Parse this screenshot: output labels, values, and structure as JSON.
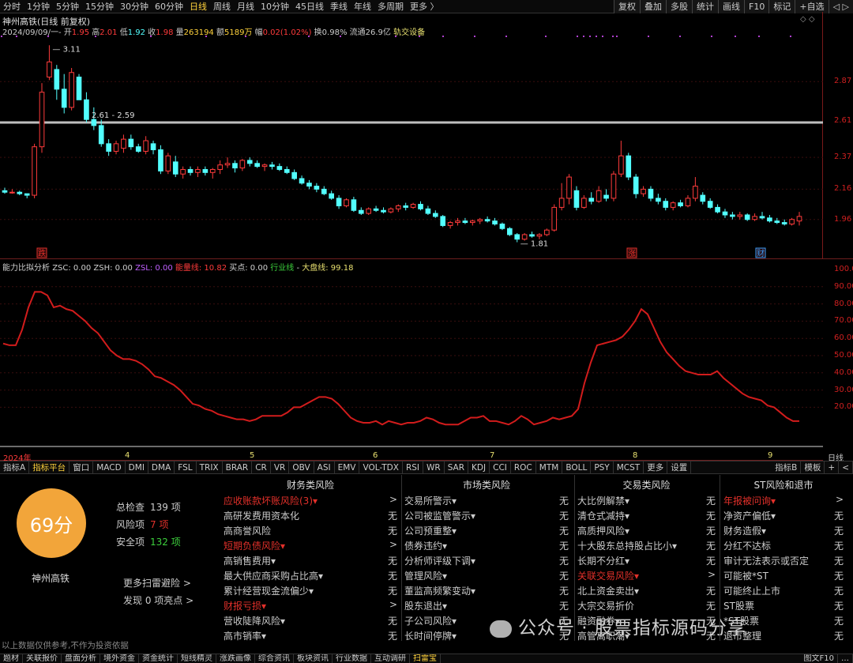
{
  "toolbar": {
    "periods": [
      "分时",
      "1分钟",
      "5分钟",
      "15分钟",
      "30分钟",
      "60分钟",
      "日线",
      "周线",
      "月线",
      "10分钟",
      "45日线",
      "季线",
      "年线",
      "多周期",
      "更多 〉"
    ],
    "active_period": "日线",
    "tools": [
      "复权",
      "叠加",
      "多股",
      "统计",
      "画线",
      "F10",
      "标记",
      "+自选",
      "◁ ▷"
    ]
  },
  "stock": {
    "title": "神州高铁(日线 前复权)",
    "date": "2024/09/09/一",
    "open_l": "开",
    "open": "1.95",
    "high_l": "高",
    "high": "2.01",
    "low_l": "低",
    "low": "1.92",
    "close_l": "收",
    "close": "1.98",
    "vol_l": "量",
    "vol": "263194",
    "amt_l": "额",
    "amt": "5189万",
    "chg_l": "幅",
    "chg": "0.02(1.02%)",
    "turn_l": "换",
    "turn": "0.98%",
    "float_l": "流通",
    "float": "26.9亿",
    "sector": "轨交设备",
    "flags": "◇ ◇"
  },
  "price_axis": [
    "2.87",
    "2.61",
    "2.37",
    "2.16",
    "1.96"
  ],
  "annotations": {
    "high": "3.11",
    "line": "2.61 - 2.59",
    "low": "1.81",
    "m1": "跌",
    "m2": "涨",
    "m3": "财"
  },
  "indicator": {
    "name": "能力比拟分析",
    "zsc": "ZSC: 0.00",
    "zsh": "ZSH: 0.00",
    "zsl": "ZSL: 0.00",
    "energy": "能量线: 10.82",
    "buy": "买点: 0.00",
    "industry": "行业线",
    "market": "大盘线: 99.18",
    "sep": "-"
  },
  "ind_axis": [
    "100.00",
    "90.00",
    "80.00",
    "70.00",
    "60.00",
    "50.00",
    "40.00",
    "30.00",
    "20.00"
  ],
  "date_axis": {
    "year": "2024年",
    "m4": "4",
    "m5": "5",
    "m6": "6",
    "m7": "7",
    "m8": "8",
    "m9": "9",
    "period": "日线"
  },
  "bottom_tabs": [
    "指标A",
    "指标平台",
    "窗口",
    "MACD",
    "DMI",
    "DMA",
    "FSL",
    "TRIX",
    "BRAR",
    "CR",
    "VR",
    "OBV",
    "ASI",
    "EMV",
    "VOL-TDX",
    "RSI",
    "WR",
    "SAR",
    "KDJ",
    "CCI",
    "ROC",
    "MTM",
    "BOLL",
    "PSY",
    "MCST",
    "更多",
    "设置"
  ],
  "bottom_right": [
    "指标B",
    "模板",
    "+",
    "<"
  ],
  "colors": {
    "up": "#ff3b3b",
    "down": "#52ffff",
    "ma": "#bfbfbf",
    "ind": "#d21c1c",
    "score": "#f2a53a"
  },
  "risk": {
    "score": "69分",
    "name": "神州高铁",
    "total_l": "总检查",
    "total": "139 项",
    "risk_l": "风险项",
    "risk": "7 项",
    "safe_l": "安全项",
    "safe": "132 项",
    "more": "更多扫雷避险 >",
    "found": "发现 0 项亮点 >"
  },
  "sections": [
    {
      "title": "财务类风险",
      "rows": [
        [
          "应收账款坏账风险(3)▾",
          ">"
        ],
        [
          "高研发费用资本化",
          "无"
        ],
        [
          "高商誉风险",
          "无"
        ],
        [
          "短期负债风险▾",
          ">"
        ],
        [
          "高销售费用▾",
          "无"
        ],
        [
          "最大供应商采购占比高▾",
          "无"
        ],
        [
          "累计经营现金流偏少▾",
          "无"
        ],
        [
          "财报亏损▾",
          ">"
        ],
        [
          "营收陡降风险▾",
          "无"
        ],
        [
          "高市销率▾",
          "无"
        ]
      ]
    },
    {
      "title": "市场类风险",
      "rows": [
        [
          "交易所警示▾",
          "无"
        ],
        [
          "公司被监管警示▾",
          "无"
        ],
        [
          "公司预重整▾",
          "无"
        ],
        [
          "债券违约▾",
          "无"
        ],
        [
          "分析师评级下调▾",
          "无"
        ],
        [
          "管理风险▾",
          "无"
        ],
        [
          "董监高频繁变动▾",
          "无"
        ],
        [
          "股东退出▾",
          "无"
        ],
        [
          "子公司风险▾",
          "无"
        ],
        [
          "长时间停牌▾",
          "无"
        ]
      ]
    },
    {
      "title": "交易类风险",
      "rows": [
        [
          "大比例解禁▾",
          "无"
        ],
        [
          "清仓式减持▾",
          "无"
        ],
        [
          "高质押风险▾",
          "无"
        ],
        [
          "十大股东总持股占比小▾",
          "无"
        ],
        [
          "长期不分红▾",
          "无"
        ],
        [
          "关联交易风险▾",
          ">"
        ],
        [
          "北上资金卖出▾",
          "无"
        ],
        [
          "大宗交易折价",
          "无"
        ],
        [
          "融资融券▾",
          "无"
        ],
        [
          "高管离职潮▾",
          "无"
        ]
      ]
    },
    {
      "title": "ST风险和退市",
      "rows": [
        [
          "年报被问询▾",
          ">"
        ],
        [
          "净资产偏低▾",
          "无"
        ],
        [
          "财务造假▾",
          "无"
        ],
        [
          "分红不达标",
          "无"
        ],
        [
          "审计无法表示或否定",
          "无"
        ],
        [
          "可能被*ST",
          "无"
        ],
        [
          "可能终止上市",
          "无"
        ],
        [
          "ST股票",
          "无"
        ],
        [
          "*ST股票",
          "无"
        ],
        [
          "退市整理",
          "无"
        ]
      ]
    }
  ],
  "red_rows": {
    "s0": [
      0,
      3,
      7
    ],
    "s2": [
      5
    ],
    "s3": [
      0
    ]
  },
  "footer_note": "以上数据仅供参考,不作为投资依据",
  "watermark": "公众号 · 股票指标源码分享",
  "bottom_nav": [
    "题材",
    "关联报价",
    "盘面分析",
    "境外资金",
    "资金统计",
    "短线精灵",
    "涨跌画像",
    "综合资讯",
    "板块资讯",
    "行业数据",
    "互动调研",
    "扫雷宝"
  ],
  "bottom_nav_right": [
    "图文F10",
    "…"
  ],
  "chart_data": {
    "type": "candlestick",
    "price_range": [
      1.75,
      3.2
    ],
    "period_high": 3.11,
    "period_low": 1.81,
    "ohlc": [
      [
        2.15,
        2.17,
        2.13,
        2.14
      ],
      [
        2.14,
        2.16,
        2.13,
        2.14
      ],
      [
        2.14,
        2.15,
        2.12,
        2.13
      ],
      [
        2.13,
        2.13,
        2.1,
        2.12
      ],
      [
        2.12,
        2.46,
        2.1,
        2.44
      ],
      [
        2.44,
        2.86,
        2.4,
        2.8
      ],
      [
        2.9,
        3.11,
        2.88,
        3.0
      ],
      [
        2.95,
        2.98,
        2.75,
        2.82
      ],
      [
        2.82,
        2.92,
        2.66,
        2.7
      ],
      [
        2.7,
        2.96,
        2.68,
        2.93
      ],
      [
        2.9,
        2.92,
        2.75,
        2.75
      ],
      [
        2.75,
        2.8,
        2.6,
        2.62
      ],
      [
        2.62,
        2.7,
        2.55,
        2.58
      ],
      [
        2.58,
        2.62,
        2.44,
        2.46
      ],
      [
        2.46,
        2.49,
        2.38,
        2.41
      ],
      [
        2.41,
        2.48,
        2.39,
        2.46
      ],
      [
        2.43,
        2.52,
        2.4,
        2.49
      ],
      [
        2.49,
        2.52,
        2.42,
        2.44
      ],
      [
        2.44,
        2.46,
        2.4,
        2.41
      ],
      [
        2.41,
        2.51,
        2.39,
        2.48
      ],
      [
        2.46,
        2.48,
        2.39,
        2.42
      ],
      [
        2.42,
        2.45,
        2.26,
        2.28
      ],
      [
        2.28,
        2.4,
        2.26,
        2.38
      ],
      [
        2.34,
        2.38,
        2.24,
        2.26
      ],
      [
        2.26,
        2.31,
        2.23,
        2.29
      ],
      [
        2.29,
        2.31,
        2.25,
        2.27
      ],
      [
        2.27,
        2.31,
        2.24,
        2.29
      ],
      [
        2.29,
        2.31,
        2.25,
        2.27
      ],
      [
        2.27,
        2.3,
        2.23,
        2.29
      ],
      [
        2.29,
        2.35,
        2.26,
        2.32
      ],
      [
        2.32,
        2.37,
        2.3,
        2.33
      ],
      [
        2.33,
        2.35,
        2.27,
        2.3
      ],
      [
        2.3,
        2.36,
        2.28,
        2.35
      ],
      [
        2.35,
        2.37,
        2.31,
        2.33
      ],
      [
        2.33,
        2.35,
        2.3,
        2.31
      ],
      [
        2.31,
        2.33,
        2.28,
        2.32
      ],
      [
        2.32,
        2.34,
        2.29,
        2.31
      ],
      [
        2.31,
        2.33,
        2.28,
        2.29
      ],
      [
        2.29,
        2.31,
        2.26,
        2.27
      ],
      [
        2.27,
        2.29,
        2.22,
        2.23
      ],
      [
        2.23,
        2.25,
        2.19,
        2.2
      ],
      [
        2.2,
        2.22,
        2.16,
        2.18
      ],
      [
        2.18,
        2.2,
        2.14,
        2.16
      ],
      [
        2.16,
        2.18,
        2.12,
        2.13
      ],
      [
        2.13,
        2.15,
        2.09,
        2.1
      ],
      [
        2.1,
        2.12,
        2.03,
        2.05
      ],
      [
        2.05,
        2.1,
        2.04,
        2.09
      ],
      [
        2.09,
        2.11,
        2.01,
        2.02
      ],
      [
        2.02,
        2.04,
        1.99,
        2.0
      ],
      [
        2.0,
        2.04,
        1.99,
        2.03
      ],
      [
        2.03,
        2.05,
        2.01,
        2.02
      ],
      [
        2.02,
        2.04,
        2.0,
        2.01
      ],
      [
        2.01,
        2.04,
        2.0,
        2.03
      ],
      [
        2.03,
        2.06,
        2.01,
        2.05
      ],
      [
        2.05,
        2.07,
        2.02,
        2.04
      ],
      [
        2.04,
        2.07,
        2.03,
        2.06
      ],
      [
        2.06,
        2.08,
        2.02,
        2.03
      ],
      [
        2.03,
        2.05,
        1.99,
        2.0
      ],
      [
        2.0,
        2.02,
        1.97,
        1.98
      ],
      [
        1.98,
        1.99,
        1.91,
        1.92
      ],
      [
        1.92,
        1.95,
        1.9,
        1.94
      ],
      [
        1.94,
        1.97,
        1.92,
        1.95
      ],
      [
        1.95,
        1.97,
        1.93,
        1.94
      ],
      [
        1.94,
        1.96,
        1.92,
        1.95
      ],
      [
        1.95,
        1.97,
        1.93,
        1.96
      ],
      [
        1.96,
        1.98,
        1.94,
        1.95
      ],
      [
        1.95,
        1.97,
        1.92,
        1.93
      ],
      [
        1.93,
        1.94,
        1.89,
        1.9
      ],
      [
        1.9,
        1.91,
        1.85,
        1.86
      ],
      [
        1.86,
        1.87,
        1.81,
        1.83
      ],
      [
        1.83,
        1.87,
        1.82,
        1.86
      ],
      [
        1.86,
        1.88,
        1.84,
        1.85
      ],
      [
        1.85,
        1.87,
        1.83,
        1.86
      ],
      [
        1.86,
        1.9,
        1.85,
        1.89
      ],
      [
        1.89,
        2.06,
        1.88,
        2.04
      ],
      [
        2.04,
        2.2,
        2.02,
        2.1
      ],
      [
        2.1,
        2.26,
        2.06,
        2.24
      ],
      [
        2.15,
        2.18,
        2.02,
        2.04
      ],
      [
        2.04,
        2.12,
        2.03,
        2.1
      ],
      [
        2.1,
        2.14,
        2.06,
        2.08
      ],
      [
        2.08,
        2.18,
        2.07,
        2.15
      ],
      [
        2.12,
        2.16,
        2.08,
        2.1
      ],
      [
        2.1,
        2.28,
        2.08,
        2.26
      ],
      [
        2.26,
        2.48,
        2.24,
        2.38
      ],
      [
        2.38,
        2.4,
        2.22,
        2.24
      ],
      [
        2.24,
        2.26,
        2.1,
        2.13
      ],
      [
        2.13,
        2.18,
        2.11,
        2.16
      ],
      [
        2.16,
        2.18,
        2.08,
        2.1
      ],
      [
        2.1,
        2.13,
        2.06,
        2.08
      ],
      [
        2.08,
        2.1,
        2.02,
        2.04
      ],
      [
        2.04,
        2.08,
        2.02,
        2.07
      ],
      [
        2.07,
        2.09,
        2.04,
        2.05
      ],
      [
        2.05,
        2.12,
        2.04,
        2.1
      ],
      [
        2.1,
        2.24,
        2.08,
        2.18
      ],
      [
        2.12,
        2.14,
        2.06,
        2.08
      ],
      [
        2.08,
        2.1,
        2.03,
        2.04
      ],
      [
        2.04,
        2.06,
        2.0,
        2.01
      ],
      [
        2.01,
        2.03,
        1.97,
        1.99
      ],
      [
        1.99,
        2.01,
        1.96,
        1.98
      ],
      [
        1.98,
        2.01,
        1.96,
        1.99
      ],
      [
        1.99,
        2.0,
        1.95,
        1.96
      ],
      [
        1.96,
        2.0,
        1.95,
        1.98
      ],
      [
        1.98,
        2.01,
        1.96,
        1.97
      ],
      [
        1.97,
        1.99,
        1.94,
        1.95
      ],
      [
        1.95,
        1.97,
        1.93,
        1.94
      ],
      [
        1.94,
        1.96,
        1.92,
        1.93
      ],
      [
        1.93,
        1.97,
        1.92,
        1.96
      ],
      [
        1.95,
        2.01,
        1.92,
        1.98
      ]
    ],
    "ma_level": 2.6,
    "indicator_range": [
      0,
      100
    ],
    "indicator": [
      57,
      56,
      56,
      65,
      78,
      87,
      87,
      85,
      78,
      79,
      77,
      76,
      73,
      70,
      66,
      63,
      58,
      53,
      50,
      48,
      48,
      47,
      45,
      42,
      38,
      37,
      35,
      33,
      30,
      26,
      22,
      21,
      19,
      18,
      16,
      15,
      14,
      13,
      13,
      12,
      13,
      15,
      15,
      15,
      15,
      17,
      20,
      20,
      22,
      24,
      26,
      26,
      25,
      22,
      18,
      14,
      12,
      11,
      11,
      12,
      10,
      12,
      11,
      10,
      11,
      11,
      12,
      14,
      13,
      11,
      10,
      10,
      10,
      12,
      14,
      14,
      15,
      12,
      12,
      11,
      10,
      12,
      15,
      13,
      10,
      11,
      12,
      14,
      13,
      14,
      15,
      19,
      34,
      46,
      56,
      57,
      58,
      59,
      61,
      65,
      70,
      77,
      74,
      66,
      58,
      52,
      48,
      44,
      41,
      40,
      39,
      39,
      39,
      41,
      37,
      34,
      31,
      28,
      26,
      25,
      24,
      21,
      20,
      17,
      14,
      12,
      12
    ]
  }
}
